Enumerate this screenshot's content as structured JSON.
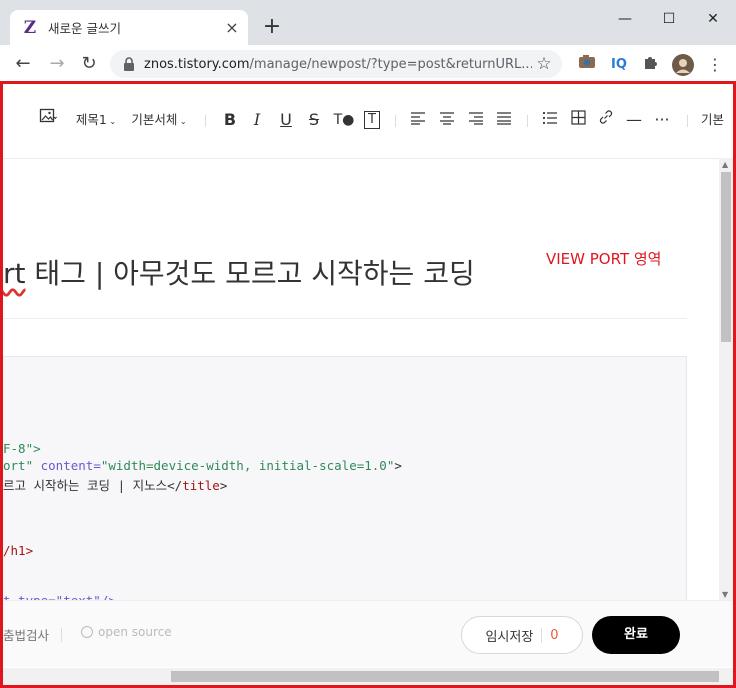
{
  "browser": {
    "tab": {
      "favicon": "Z",
      "title": "새로운 글쓰기",
      "close_label": "×"
    },
    "new_tab_label": "+",
    "window_controls": {
      "minimize": "—",
      "maximize": "☐",
      "close": "✕"
    },
    "nav": {
      "back": "←",
      "forward": "→",
      "reload": "↻"
    },
    "url": {
      "host": "znos.tistory.com",
      "path": "/manage/newpost/?type=post&returnURL..."
    },
    "extensions": [
      "camera-icon",
      "iq-icon",
      "puzzle-icon",
      "avatar",
      "menu-dots-icon"
    ],
    "ext_iq_label": "IQ"
  },
  "editor_toolbar": {
    "image_icon": "image-icon",
    "heading_label": "제목1",
    "font_label": "기본서체",
    "bold": "B",
    "italic": "I",
    "underline": "U",
    "strike": "S",
    "text_color": "T●",
    "text_bg": "T",
    "right_cut_label": "기본"
  },
  "post": {
    "title_wavy": "rt",
    "title_rest": " 태그 | 아무것도 모르고 시작하는 코딩",
    "viewport_annotation": "VIEW PORT 영역"
  },
  "code": {
    "line1": "F-8\">",
    "line2_a": "ort\"",
    "line2_b": " content=",
    "line2_c": "\"width=device-width, initial-scale=1.0\"",
    "line2_d": ">",
    "line3_a": "르고 시작하는 코딩 | 지노스</",
    "line3_b": "title",
    "line3_c": ">",
    "line4": "/h1>",
    "line5": "t type=\"text\"/>"
  },
  "bottom_bar": {
    "spellcheck_label": "춤법검사",
    "open_source_label": "open source",
    "temp_save_label": "임시저장",
    "temp_save_count": "0",
    "done_label": "완료"
  },
  "colors": {
    "highlight_border": "#e0161f",
    "accent_count": "#e8593c",
    "done_bg": "#000000"
  }
}
